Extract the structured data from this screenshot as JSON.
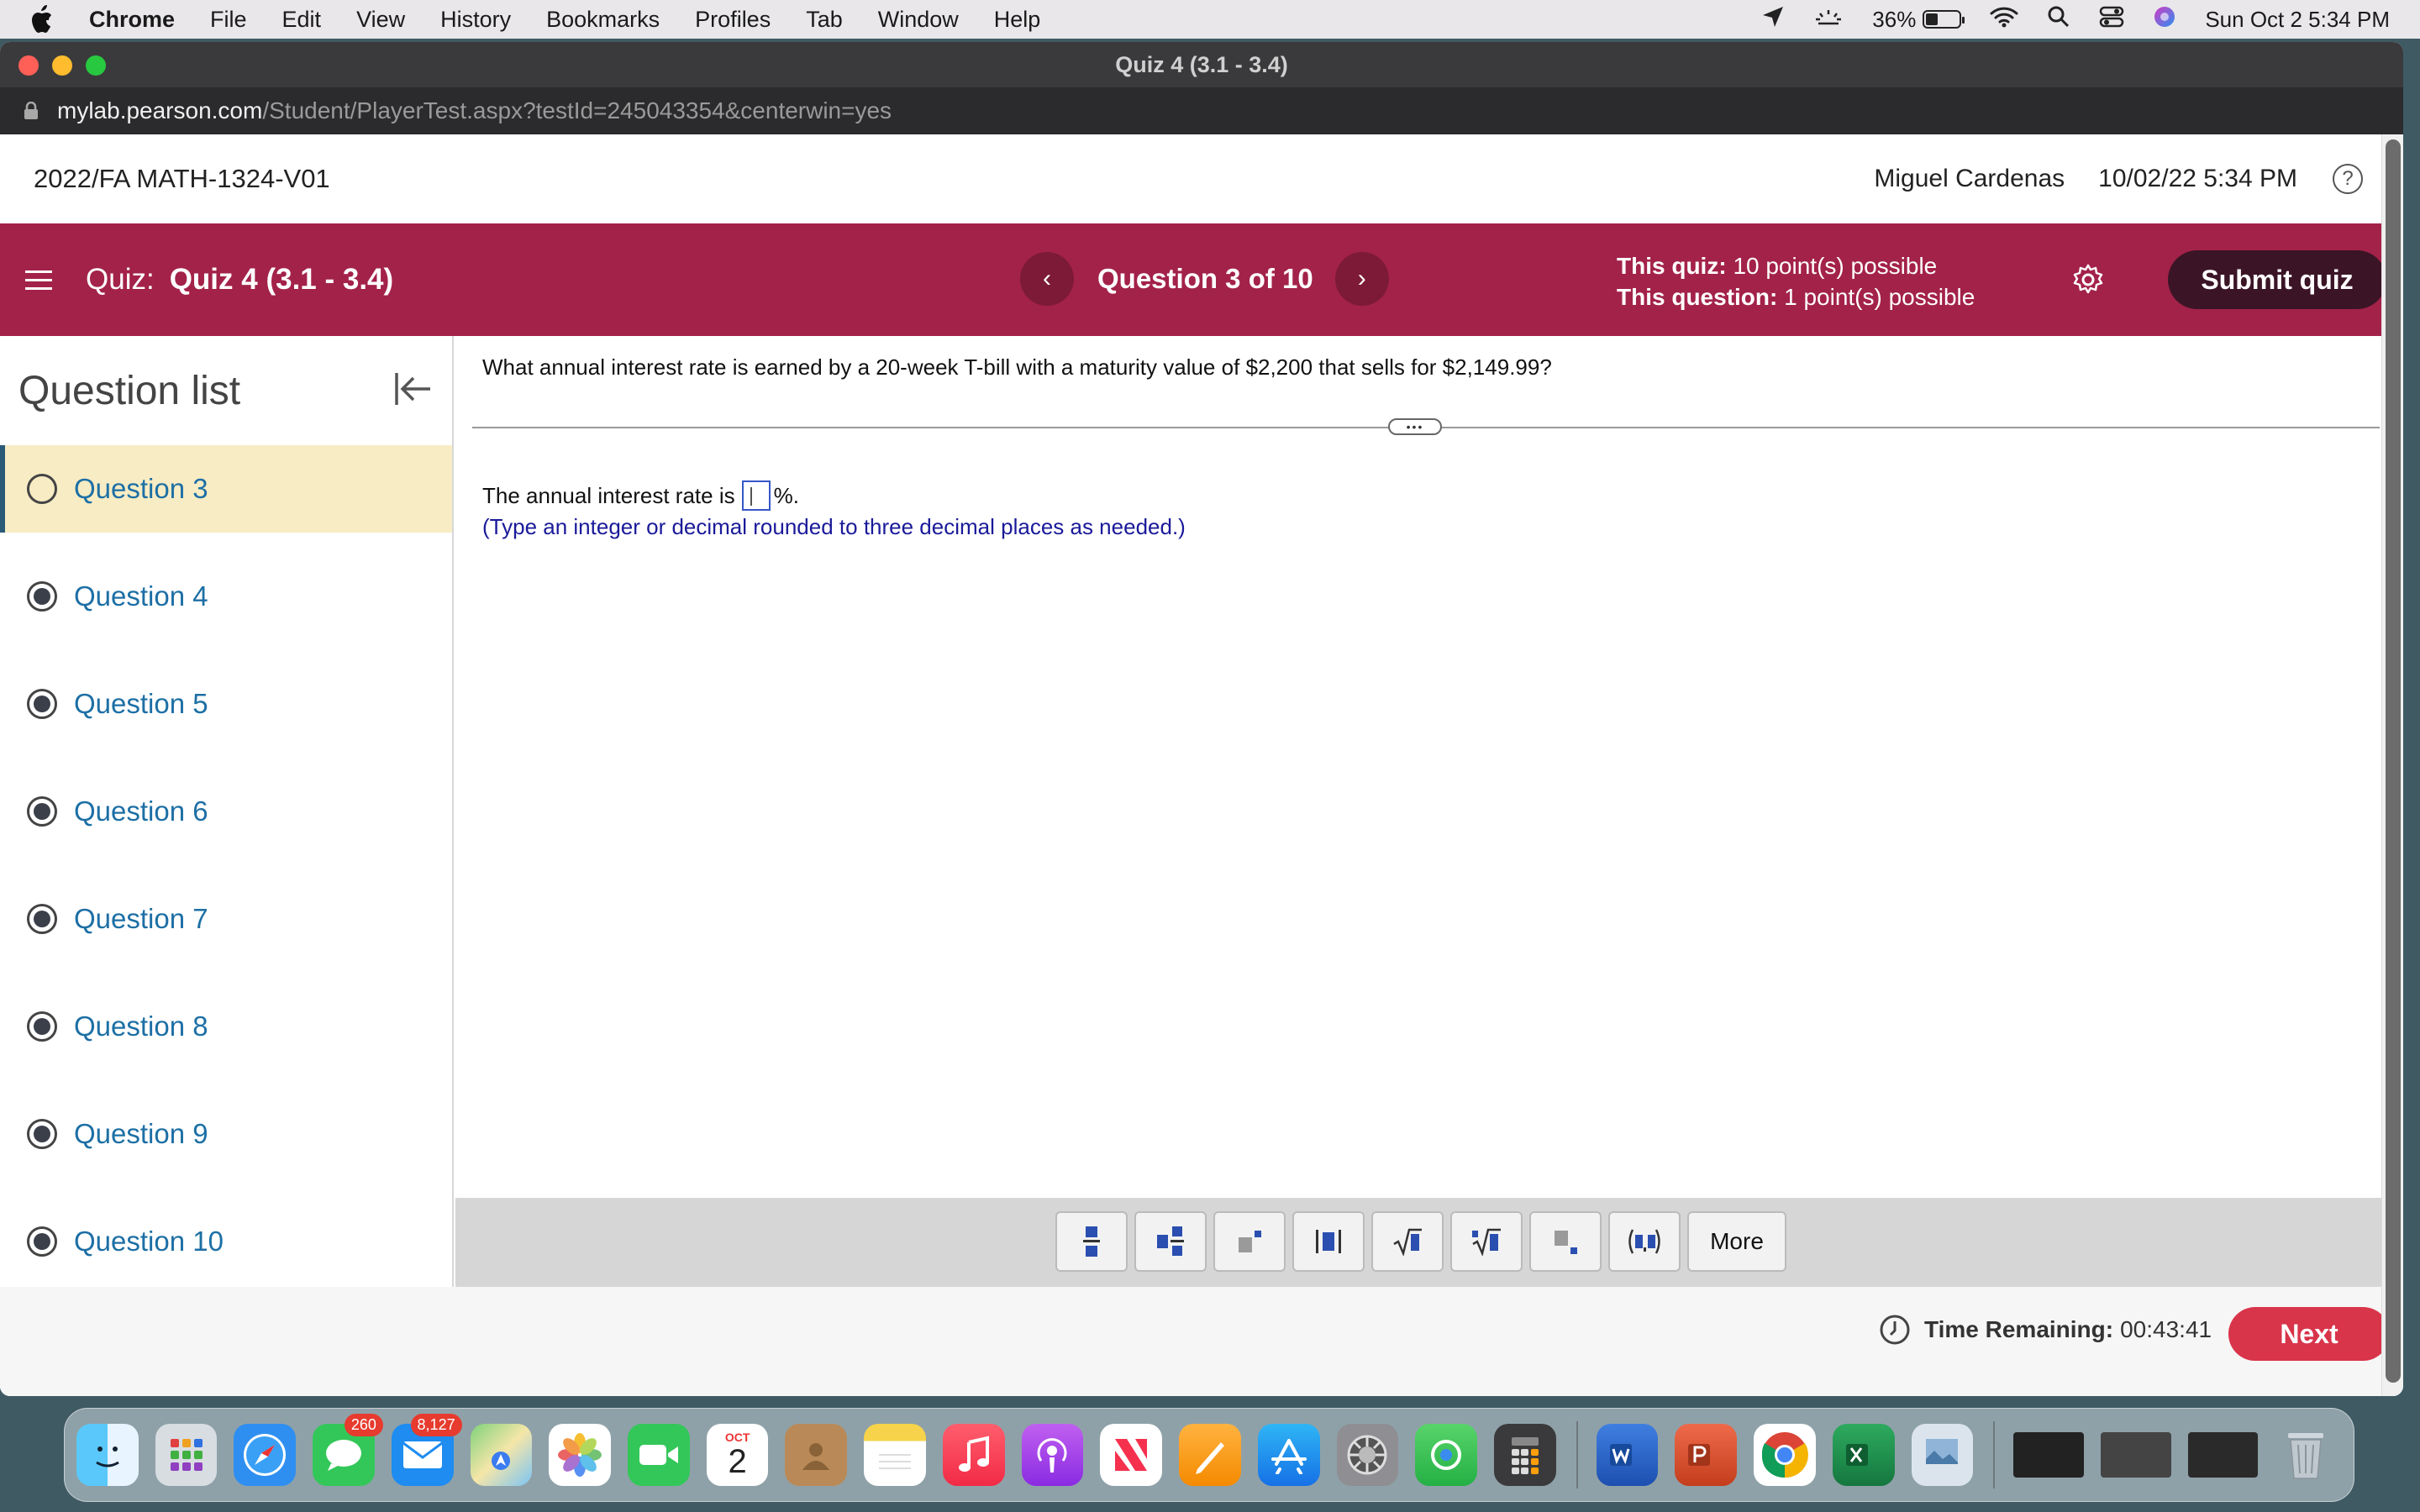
{
  "menubar": {
    "app": "Chrome",
    "items": [
      "File",
      "Edit",
      "View",
      "History",
      "Bookmarks",
      "Profiles",
      "Tab",
      "Window",
      "Help"
    ],
    "battery": "36%",
    "battery_level": 0.36,
    "datetime": "Sun Oct 2  5:34 PM"
  },
  "browser": {
    "title": "Quiz 4 (3.1 - 3.4)",
    "url_host": "mylab.pearson.com",
    "url_path": "/Student/PlayerTest.aspx?testId=245043354&centerwin=yes"
  },
  "course": {
    "title": "2022/FA MATH-1324-V01",
    "user": "Miguel Cardenas",
    "datetime": "10/02/22 5:34 PM",
    "help": "?"
  },
  "quizbar": {
    "label": "Quiz:",
    "name": "Quiz 4 (3.1 - 3.4)",
    "prev": "‹",
    "next": "›",
    "question_position": "Question 3 of 10",
    "quiz_points_label": "This quiz:",
    "quiz_points": "10 point(s) possible",
    "question_points_label": "This question:",
    "question_points": "1 point(s) possible",
    "submit": "Submit quiz"
  },
  "sidebar": {
    "title": "Question list",
    "items": [
      {
        "label": "Question 3",
        "answered": false
      },
      {
        "label": "Question 4",
        "answered": true
      },
      {
        "label": "Question 5",
        "answered": true
      },
      {
        "label": "Question 6",
        "answered": true
      },
      {
        "label": "Question 7",
        "answered": true
      },
      {
        "label": "Question 8",
        "answered": true
      },
      {
        "label": "Question 9",
        "answered": true
      },
      {
        "label": "Question 10",
        "answered": true
      }
    ]
  },
  "question": {
    "text": "What annual interest rate is earned by a 20-week T-bill with a maturity value of $2,200 that sells for $2,149.99?",
    "divider_handle": "•••",
    "answer_prefix": "The annual interest rate is",
    "answer_value": "",
    "answer_suffix": "%.",
    "hint": "(Type an integer or decimal rounded to three decimal places as needed.)"
  },
  "toolbar": {
    "tools": [
      "fraction",
      "mixed-number",
      "exponent",
      "absolute-value",
      "square-root",
      "nth-root",
      "subscript",
      "ordered-pair"
    ],
    "more": "More",
    "close": "×"
  },
  "footer": {
    "time_label": "Time Remaining:",
    "time_value": "00:43:41",
    "next": "Next"
  },
  "dock": {
    "messages_badge": "260",
    "mail_badge": "8,127",
    "calendar_month": "OCT",
    "calendar_day": "2",
    "apps": [
      "finder",
      "launchpad",
      "safari",
      "messages",
      "mail",
      "maps",
      "photos",
      "facetime",
      "calendar",
      "contacts",
      "notes",
      "music",
      "podcasts",
      "news",
      "pages",
      "app-store",
      "system-preferences",
      "find-my",
      "calculator",
      "word",
      "powerpoint",
      "chrome",
      "excel",
      "preview",
      "trash"
    ]
  }
}
